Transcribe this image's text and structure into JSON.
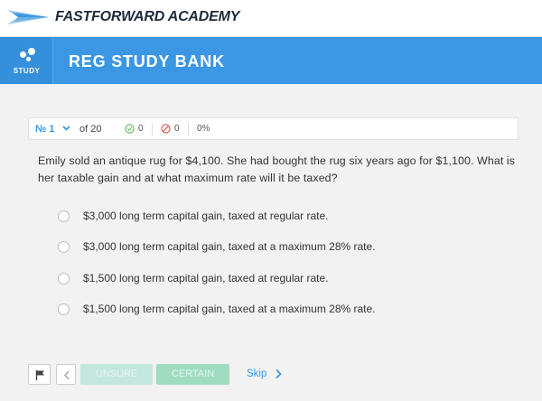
{
  "brand": {
    "name_part1": "FAST",
    "name_part2": "FORWARD",
    "name_part3": " ACADEMY"
  },
  "header": {
    "tab_label": "STUDY",
    "title": "REG STUDY BANK"
  },
  "status": {
    "question_number": "№ 1",
    "of_total": "of 20",
    "correct_count": "0",
    "incorrect_count": "0",
    "percent": "0%"
  },
  "question": {
    "text": "Emily sold an antique rug for $4,100. She had bought the rug six years ago for $1,100. What is her taxable gain and at what maximum rate will it be taxed?",
    "choices": [
      "$3,000 long term capital gain, taxed at regular rate.",
      "$3,000 long term capital gain, taxed at a maximum 28% rate.",
      "$1,500 long term capital gain, taxed at regular rate.",
      "$1,500 long term capital gain, taxed at a maximum 28% rate."
    ]
  },
  "controls": {
    "unsure_label": "UNSURE",
    "certain_label": "CERTAIN",
    "skip_label": "Skip"
  },
  "colors": {
    "header_blue": "#3b97e3",
    "correct_green": "#5cb85c",
    "incorrect_red": "#d9534f",
    "unsure_bg": "#c3e6dd",
    "certain_bg": "#9fdcc1"
  },
  "icons": {
    "logo": "arrow-wings-logo-icon",
    "study": "study-dots-icon",
    "chevron": "chevron-down-icon",
    "correct": "check-circle-icon",
    "incorrect": "ban-circle-icon",
    "flag": "flag-icon",
    "back": "chevron-left-icon",
    "skip": "chevron-right-icon"
  }
}
